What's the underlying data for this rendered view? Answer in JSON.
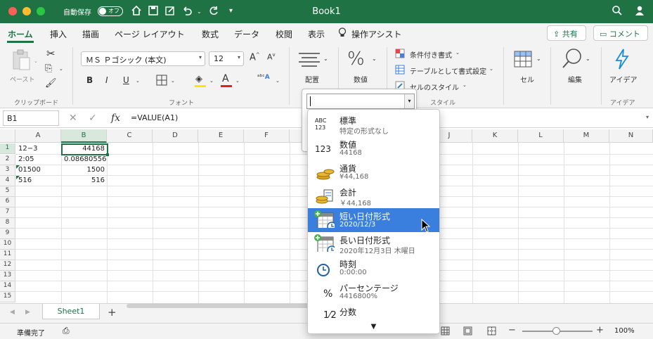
{
  "window": {
    "title": "Book1",
    "autosave_label": "自動保存",
    "autosave_state": "オフ"
  },
  "tabs": [
    "ホーム",
    "挿入",
    "描画",
    "ページ レイアウト",
    "数式",
    "データ",
    "校閲",
    "表示",
    "操作アシスト"
  ],
  "actions": {
    "share": "共有",
    "comment": "コメント"
  },
  "ribbon": {
    "paste": "ペースト",
    "clipboard_group": "クリップボード",
    "font_name": "ＭＳ Ｐゴシック (本文)",
    "font_size": "12",
    "bold": "B",
    "italic": "I",
    "underline": "U",
    "font_group": "フォント",
    "align": "配置",
    "number": "数値",
    "cond_format": "条件付き書式",
    "table_format": "テーブルとして書式設定",
    "cell_style": "セルのスタイル",
    "style_group": "スタイル",
    "cells": "セル",
    "edit": "編集",
    "ideas": "アイデア",
    "ideas_group": "アイデア"
  },
  "formula_bar": {
    "name_box": "B1",
    "formula": "=VALUE(A1)"
  },
  "columns": [
    "A",
    "B",
    "C",
    "D",
    "E",
    "F",
    "G",
    "H",
    "I",
    "J",
    "K",
    "L",
    "M",
    "N"
  ],
  "rows": [
    "1",
    "2",
    "3",
    "4",
    "5",
    "6",
    "7",
    "8",
    "9",
    "10",
    "11",
    "12",
    "13",
    "14",
    "15"
  ],
  "cells": {
    "a1": "12−3",
    "b1": "44168",
    "a2": "2:05",
    "b2": "0.08680556",
    "a3": "01500",
    "b3": "1500",
    "a4": "516",
    "b4": "516"
  },
  "sheet_tab": "Sheet1",
  "status": {
    "ready": "準備完了",
    "zoom": "100%"
  },
  "number_format_menu": [
    {
      "name": "標準",
      "sub": "特定の形式なし",
      "icon": "ABC 123"
    },
    {
      "name": "数値",
      "sub": "44168",
      "icon": "123"
    },
    {
      "name": "通貨",
      "sub": "¥44,168",
      "icon": "coins-icon"
    },
    {
      "name": "会計",
      "sub": "￥44,168",
      "icon": "accounting-icon"
    },
    {
      "name": "短い日付形式",
      "sub": "2020/12/3",
      "icon": "calendar-icon"
    },
    {
      "name": "長い日付形式",
      "sub": "2020年12月3日 木曜日",
      "icon": "calendar-icon"
    },
    {
      "name": "時刻",
      "sub": "0:00:00",
      "icon": "clock-icon"
    },
    {
      "name": "パーセンテージ",
      "sub": "4416800%",
      "icon": "%"
    },
    {
      "name": "分数",
      "sub": "",
      "icon": "1/2"
    }
  ],
  "icons": {
    "abc": "ABC",
    "n123": "123",
    "percent": "%",
    "fraction": "1⁄2",
    "fx": "fx"
  },
  "colors": {
    "brand": "#1f7244",
    "selection": "#3a7fde"
  }
}
